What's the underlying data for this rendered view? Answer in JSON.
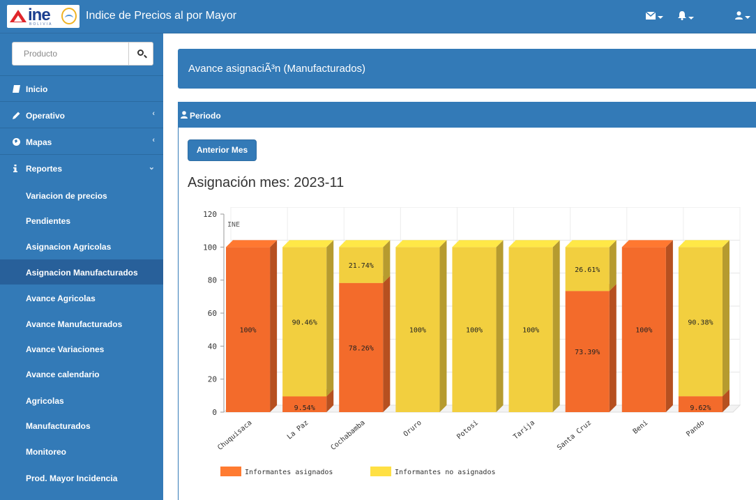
{
  "app": {
    "title": "Indice de Precios al por Mayor",
    "logo_text": "ine",
    "logo_sub": "BOLIVIA"
  },
  "navbar": {
    "icons": [
      "envelope-icon",
      "bell-icon",
      "user-icon"
    ]
  },
  "sidebar": {
    "search": {
      "placeholder": "Producto",
      "value": ""
    },
    "items": [
      {
        "label": "Inicio",
        "icon": "book-icon",
        "chevron": ""
      },
      {
        "label": "Operativo",
        "icon": "pencil-icon",
        "chevron": "‹"
      },
      {
        "label": "Mapas",
        "icon": "globe-icon",
        "chevron": "‹"
      },
      {
        "label": "Reportes",
        "icon": "info-icon",
        "chevron": "⌄"
      }
    ],
    "subitems": [
      {
        "label": "Variacion de precios"
      },
      {
        "label": "Pendientes"
      },
      {
        "label": "Asignacion Agricolas"
      },
      {
        "label": "Asignacion Manufacturados",
        "active": true
      },
      {
        "label": "Avance Agricolas"
      },
      {
        "label": "Avance Manufacturados"
      },
      {
        "label": "Avance Variaciones"
      },
      {
        "label": "Avance calendario"
      },
      {
        "label": "Agricolas"
      },
      {
        "label": "Manufacturados"
      },
      {
        "label": "Monitoreo"
      },
      {
        "label": "Prod. Mayor Incidencia"
      }
    ]
  },
  "main": {
    "page_title": "Avance asignaciÃ³n (Manufacturados)",
    "panel_title": "Periodo",
    "prev_button": "Anterior Mes",
    "chart_heading": "Asignación mes: 2023-11",
    "watermark": "INE"
  },
  "colors": {
    "primary": "#337ab7",
    "assigned": "#f36b2b",
    "not_assigned": "#f2cf3f"
  },
  "chart_data": {
    "type": "bar",
    "stacked": true,
    "title": "Asignación mes: 2023-11",
    "categories": [
      "Chuquisaca",
      "La Paz",
      "Cochabamba",
      "Oruro",
      "Potosi",
      "Tarija",
      "Santa Cruz",
      "Beni",
      "Pando"
    ],
    "series": [
      {
        "name": "Informantes asignados",
        "values": [
          100,
          9.54,
          78.26,
          0,
          0,
          0,
          73.39,
          100,
          9.62
        ],
        "labels": [
          "100%",
          "9.54%",
          "78.26%",
          "",
          "",
          "",
          "73.39%",
          "100%",
          "9.62%"
        ],
        "color": "#f36b2b"
      },
      {
        "name": "Informantes no asignados",
        "values": [
          0,
          90.46,
          21.74,
          100,
          100,
          100,
          26.61,
          0,
          90.38
        ],
        "labels": [
          "",
          "90.46%",
          "21.74%",
          "100%",
          "100%",
          "100%",
          "26.61%",
          "",
          "90.38%"
        ],
        "color": "#f2cf3f"
      }
    ],
    "ylim": [
      0,
      120
    ],
    "yticks": [
      0,
      20,
      40,
      60,
      80,
      100,
      120
    ],
    "grid": true,
    "legend": "bottom-left",
    "three_d": true
  }
}
